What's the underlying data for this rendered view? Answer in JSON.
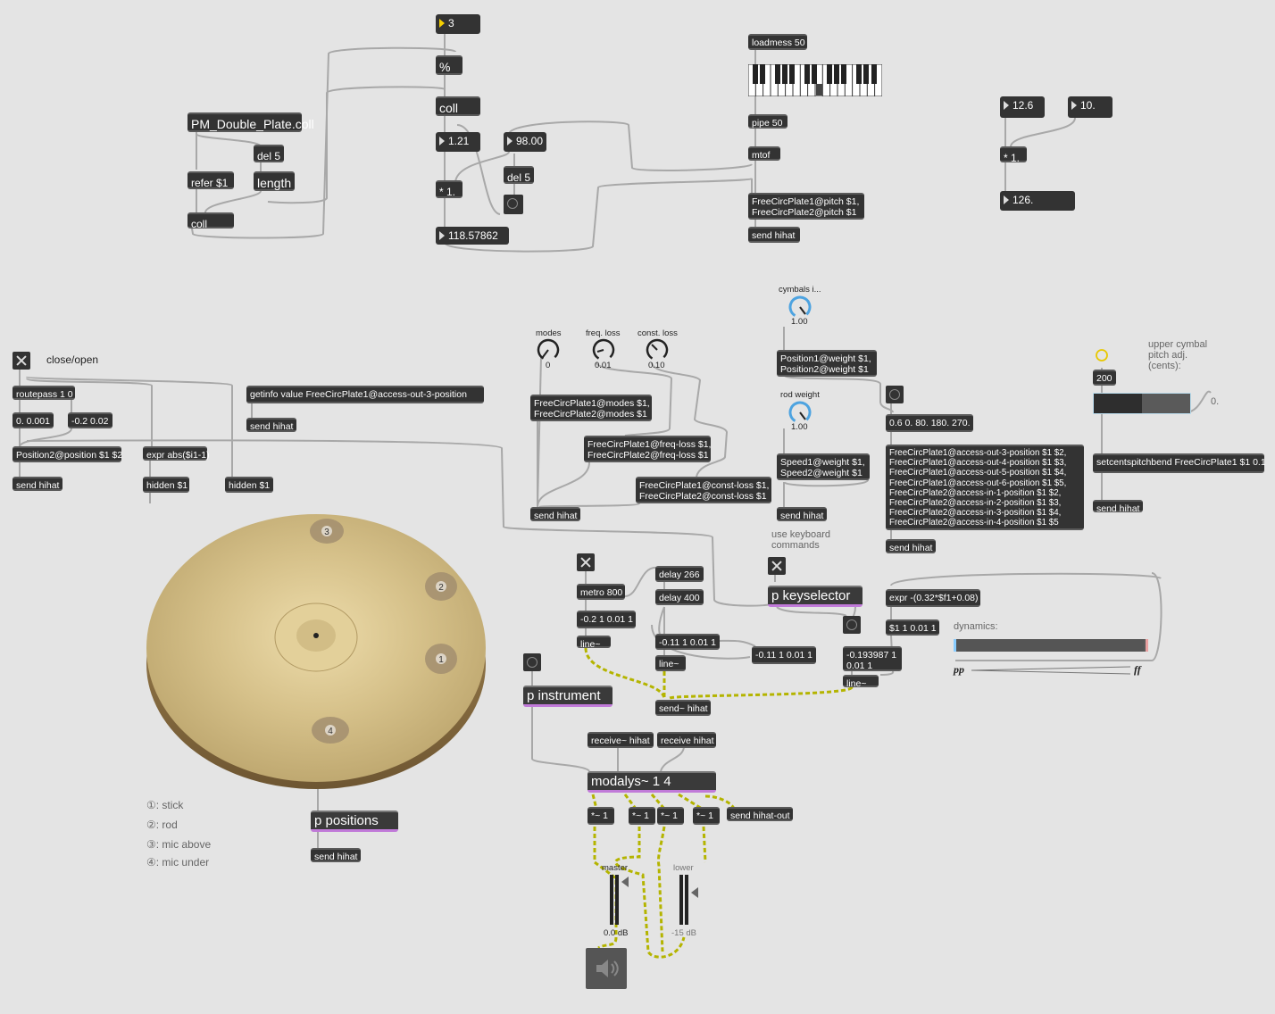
{
  "top_patch": {
    "mod_input": "3",
    "modulo": "%",
    "coll_top": "coll",
    "coll_file": "PM_Double_Plate.coll",
    "del5_a": "del 5",
    "refer": "refer $1",
    "length": "length",
    "coll_bottom": "coll",
    "num_121": "1.21",
    "num_98": "98.00",
    "del5_b": "del 5",
    "mult": "* 1.",
    "num_result": "118.57862",
    "loadmess": "loadmess 50",
    "pipe": "pipe 50",
    "mtof": "mtof",
    "pitch_msg": "FreeCircPlate1@pitch $1,\nFreeCircPlate2@pitch $1",
    "send_pitch": "send hihat"
  },
  "calc_patch": {
    "num_a": "12.6",
    "num_b": "10.",
    "mult": "* 1.",
    "result": "126."
  },
  "close_open": {
    "label": "close/open",
    "routepass": "routepass 1 0",
    "msg_a": "0. 0.001",
    "msg_b": "-0.2 0.02",
    "position_msg": "Position2@position $1 $2",
    "send": "send hihat",
    "expr_abs": "expr abs($i1-1)",
    "hidden_a": "hidden $1",
    "hidden_b": "hidden $1",
    "getinfo": "getinfo value FreeCircPlate1@access-out-3-position",
    "send_getinfo": "send hihat"
  },
  "plate_params": {
    "modes_label": "modes",
    "modes_value": "0",
    "freq_loss_label": "freq. loss",
    "freq_loss_value": "0.01",
    "const_loss_label": "const. loss",
    "const_loss_value": "0.10",
    "modes_msg": "FreeCircPlate1@modes $1,\nFreeCircPlate2@modes $1",
    "freq_msg": "FreeCircPlate1@freq-loss $1,\nFreeCircPlate2@freq-loss $1",
    "const_msg": "FreeCircPlate1@const-loss $1,\nFreeCircPlate2@const-loss $1",
    "send": "send hihat"
  },
  "weights": {
    "cymbals_label": "cymbals i...",
    "cymbals_value": "1.00",
    "position_msg": "Position1@weight $1,\nPosition2@weight $1",
    "rod_label": "rod weight",
    "rod_value": "1.00",
    "speed_msg": "Speed1@weight $1,\nSpeed2@weight $1",
    "send": "send hihat"
  },
  "access": {
    "list_msg": "0.6 0. 80. 180. 270.",
    "positions_msg": "FreeCircPlate1@access-out-3-position $1 $2,\nFreeCircPlate1@access-out-4-position $1 $3,\nFreeCircPlate1@access-out-5-position $1 $4,\nFreeCircPlate1@access-out-6-position $1 $5,\nFreeCircPlate2@access-in-1-position $1 $2,\nFreeCircPlate2@access-in-2-position $1 $3,\nFreeCircPlate2@access-in-3-position $1 $4,\nFreeCircPlate2@access-in-4-position $1 $5",
    "send": "send hihat"
  },
  "pitch_adj": {
    "label": "upper cymbal\npitch adj.\n(cents):",
    "value": "200",
    "slider_readout": "0.",
    "msg": "setcentspitchbend FreeCircPlate1 $1 0.1",
    "send": "send hihat"
  },
  "sequencer": {
    "metro": "metro 800",
    "delay_266": "delay 266",
    "delay_400": "delay 400",
    "msg_a": "-0.2 1 0.01 1",
    "line_a": "line~",
    "msg_b": "-0.11 1 0.01 1",
    "msg_c": "-0.11 1 0.01 1",
    "line_b": "line~",
    "send_sig": "send~ hihat",
    "keyboard_label": "use keyboard\ncommands",
    "keyselector": "p keyselector",
    "msg_d": "-0.193987 1\n0.01 1",
    "line_c": "line~"
  },
  "dynamics": {
    "expr": "expr -(0.32*$f1+0.08)",
    "msg": "$1 1 0.01 1",
    "label": "dynamics:",
    "pp": "pp",
    "ff": "ff",
    "level": 0.99
  },
  "cymbal": {
    "mark_1": "1",
    "mark_2": "2",
    "mark_3": "3",
    "mark_4": "4",
    "legend": [
      "①: stick",
      "②: rod",
      "③: mic above",
      "④: mic under"
    ],
    "positions": "p positions",
    "send": "send hihat"
  },
  "engine": {
    "instrument": "p instrument",
    "receive_sig": "receive~ hihat",
    "receive": "receive hihat",
    "modalys": "modalys~ 1 4",
    "gain_1": "*~ 1",
    "gain_2": "*~ 1",
    "gain_3": "*~ 1",
    "gain_4": "*~ 1",
    "send_out": "send hihat-out",
    "master_label": "master",
    "master_db": "0.0 dB",
    "lower_label": "lower",
    "lower_db": "-15 dB"
  },
  "colors": {
    "background": "#e4e4e4",
    "object": "#333333",
    "subpatch_accent": "#c07ad8",
    "signal_cord": "#c8c800",
    "dial_accent": "#4da3e0"
  }
}
